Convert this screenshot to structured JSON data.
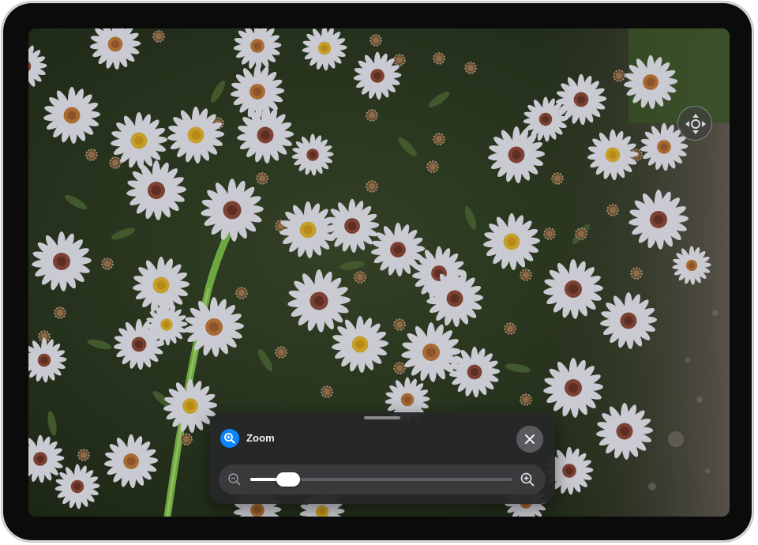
{
  "zoom_panel": {
    "title": "Zoom",
    "title_icon": "zoom-magnifier-icon",
    "close_icon": "close-icon",
    "slider": {
      "min_icon": "zoom-out-icon",
      "max_icon": "zoom-in-icon",
      "level": 0.1
    }
  },
  "overlay": {
    "move_handle_icon": "move-arrows-icon"
  },
  "colors": {
    "accent": "#0a84ff",
    "panel_bg": "#262628",
    "bezel": "#0b0b0b"
  }
}
